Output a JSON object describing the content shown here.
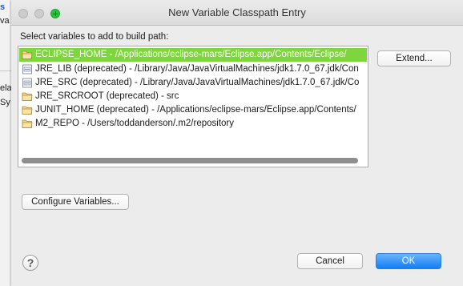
{
  "background_window": {
    "fragments": [
      "s",
      "va",
      "ela",
      "Sy"
    ]
  },
  "dialog": {
    "title": "New Variable Classpath Entry",
    "prompt": "Select variables to add to build path:",
    "entries": [
      {
        "text": "ECLIPSE_HOME - /Applications/eclipse-mars/Eclipse.app/Contents/Eclipse/",
        "icon": "folder-icon",
        "selected": true
      },
      {
        "text": "JRE_LIB (deprecated) - /Library/Java/JavaVirtualMachines/jdk1.7.0_67.jdk/Con",
        "icon": "jar-icon",
        "selected": false
      },
      {
        "text": "JRE_SRC (deprecated) - /Library/Java/JavaVirtualMachines/jdk1.7.0_67.jdk/Co",
        "icon": "jar-icon",
        "selected": false
      },
      {
        "text": "JRE_SRCROOT (deprecated) - src",
        "icon": "folder-icon",
        "selected": false
      },
      {
        "text": "JUNIT_HOME (deprecated) - /Applications/eclipse-mars/Eclipse.app/Contents/",
        "icon": "folder-icon",
        "selected": false
      },
      {
        "text": "M2_REPO - /Users/toddanderson/.m2/repository",
        "icon": "folder-icon",
        "selected": false
      }
    ],
    "buttons": {
      "extend": "Extend...",
      "configure": "Configure Variables...",
      "cancel": "Cancel",
      "ok": "OK"
    },
    "help_glyph": "?"
  },
  "colors": {
    "selection": "#7dd63c",
    "primary_button": "#1a82fb",
    "zoom_button": "#2bc140"
  }
}
